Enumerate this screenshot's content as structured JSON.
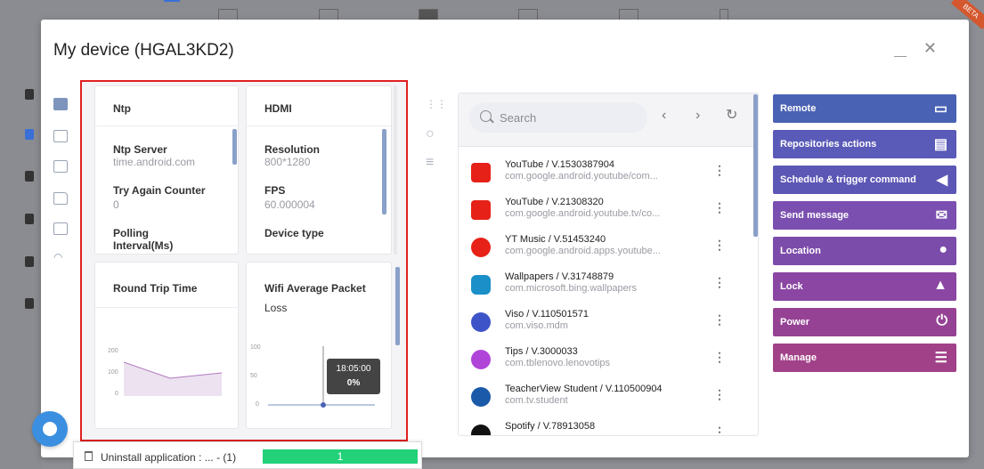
{
  "modal": {
    "title": "My device (HGAL3KD2)"
  },
  "cards": {
    "ntp": {
      "title": "Ntp",
      "fields": [
        {
          "label": "Ntp Server",
          "value": "time.android.com"
        },
        {
          "label": "Try Again Counter",
          "value": "0"
        },
        {
          "label": "Polling",
          "value": "Interval(Ms)"
        }
      ]
    },
    "hdmi": {
      "title": "HDMI",
      "fields": [
        {
          "label": "Resolution",
          "value": "800*1280"
        },
        {
          "label": "FPS",
          "value": "60.000004"
        },
        {
          "label": "Device type",
          "value": ""
        }
      ]
    },
    "rtt": {
      "title": "Round Trip Time",
      "ticks": [
        "200",
        "100",
        "0"
      ]
    },
    "wifi": {
      "title": "Wifi Average Packet",
      "title2": "Loss",
      "ticks": [
        "100",
        "50",
        "0"
      ],
      "tooltip_time": "18:05:00",
      "tooltip_value": "0%"
    }
  },
  "apps": {
    "search_placeholder": "Search",
    "items": [
      {
        "name": "YouTube / V.1530387904",
        "pkg": "com.google.android.youtube/com...",
        "color": "#e62117"
      },
      {
        "name": "YouTube / V.21308320",
        "pkg": "com.google.android.youtube.tv/co...",
        "color": "#e62117"
      },
      {
        "name": "YT Music / V.51453240",
        "pkg": "com.google.android.apps.youtube...",
        "color": "#e62117"
      },
      {
        "name": "Wallpapers / V.31748879",
        "pkg": "com.microsoft.bing.wallpapers",
        "color": "#1a8fc8"
      },
      {
        "name": "Viso / V.110501571",
        "pkg": "com.viso.mdm",
        "color": "#3d54c8"
      },
      {
        "name": "Tips / V.3000033",
        "pkg": "com.tblenovo.lenovotips",
        "color": "#b044d8"
      },
      {
        "name": "TeacherView Student / V.110500904",
        "pkg": "com.tv.student",
        "color": "#1a5aa8"
      },
      {
        "name": "Spotify / V.78913058",
        "pkg": "",
        "color": "#1db954"
      }
    ]
  },
  "actions": [
    {
      "label": "Remote",
      "icon": "monitor-icon",
      "color": "#4a62b4"
    },
    {
      "label": "Repositories actions",
      "icon": "clipboard-icon",
      "color": "#5a5ab8"
    },
    {
      "label": "Schedule & trigger command",
      "icon": "megaphone-icon",
      "color": "#5c56b4"
    },
    {
      "label": "Send message",
      "icon": "envelope-icon",
      "color": "#7a4fb0"
    },
    {
      "label": "Location",
      "icon": "location-pin-icon",
      "color": "#7c4caa"
    },
    {
      "label": "Lock",
      "icon": "lock-icon",
      "color": "#8a46a2"
    },
    {
      "label": "Power",
      "icon": "power-icon",
      "color": "#954294"
    },
    {
      "label": "Manage",
      "icon": "checklist-icon",
      "color": "#a14188"
    }
  ],
  "uninstall": {
    "label": "Uninstall application : ...   - (1)",
    "count": "1"
  },
  "badge": "BETA"
}
